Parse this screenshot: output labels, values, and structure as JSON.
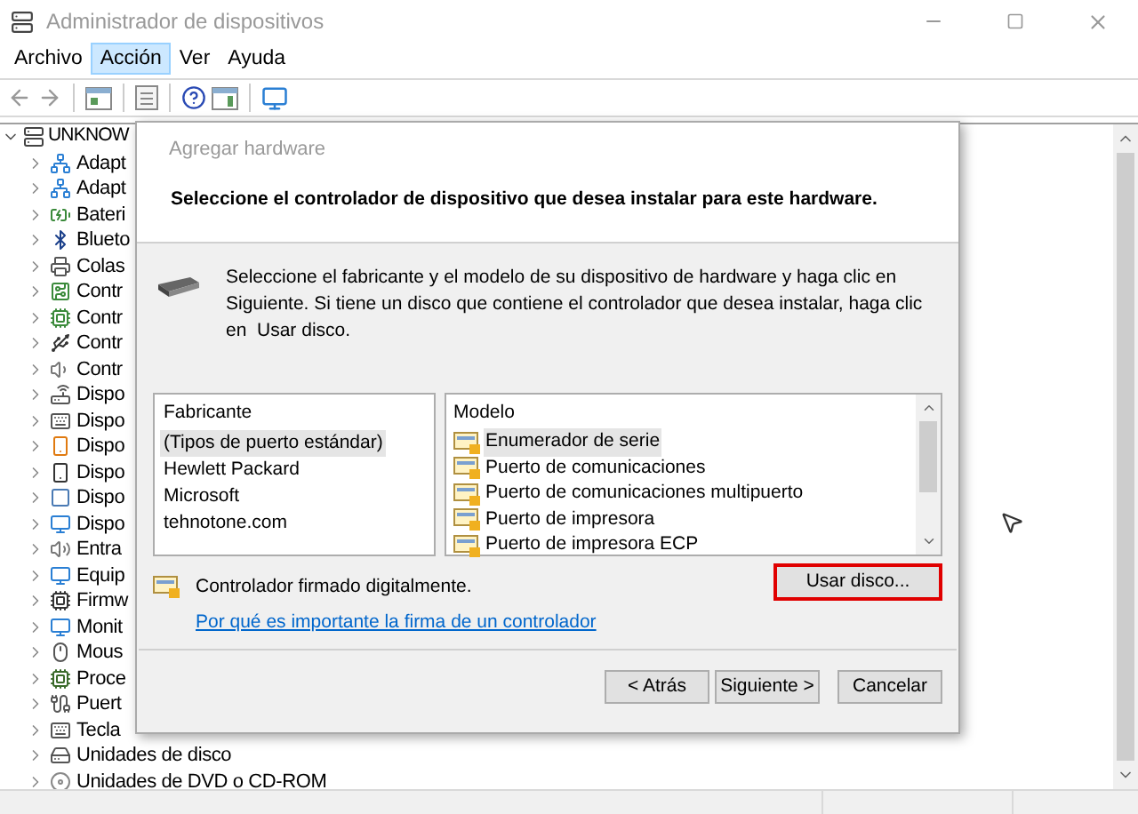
{
  "window": {
    "title": "Administrador de dispositivos"
  },
  "menu": [
    {
      "label": "Archivo",
      "selected": false
    },
    {
      "label": "Acción",
      "selected": true
    },
    {
      "label": "Ver",
      "selected": false
    },
    {
      "label": "Ayuda",
      "selected": false
    }
  ],
  "tree": {
    "label": "UNKNOW",
    "expanded": true,
    "children": [
      {
        "label": "Adapt",
        "expanded": false
      },
      {
        "label": "Adapt",
        "expanded": false
      },
      {
        "label": "Bateri",
        "expanded": false
      },
      {
        "label": "Blueto",
        "expanded": false
      },
      {
        "label": "Colas",
        "expanded": false
      },
      {
        "label": "Contr",
        "expanded": false
      },
      {
        "label": "Contr",
        "expanded": false
      },
      {
        "label": "Contr",
        "expanded": false
      },
      {
        "label": "Contr",
        "expanded": false
      },
      {
        "label": "Dispo",
        "expanded": false
      },
      {
        "label": "Dispo",
        "expanded": false
      },
      {
        "label": "Dispo",
        "expanded": false
      },
      {
        "label": "Dispo",
        "expanded": false
      },
      {
        "label": "Dispo",
        "expanded": false
      },
      {
        "label": "Dispo",
        "expanded": false
      },
      {
        "label": "Entra",
        "expanded": false
      },
      {
        "label": "Equip",
        "expanded": false
      },
      {
        "label": "Firmw",
        "expanded": false
      },
      {
        "label": "Monit",
        "expanded": false
      },
      {
        "label": "Mous",
        "expanded": false
      },
      {
        "label": "Proce",
        "expanded": false
      },
      {
        "label": "Puert",
        "expanded": false
      },
      {
        "label": "Tecla",
        "expanded": false
      },
      {
        "label": "Unidades de disco",
        "expanded": false
      },
      {
        "label": "Unidades de DVD o CD-ROM",
        "expanded": false
      }
    ]
  },
  "dialog": {
    "title": "Agregar hardware",
    "heading": "Seleccione el controlador de dispositivo que desea instalar para este hardware.",
    "instructions": "Seleccione el fabricante y el modelo de su dispositivo de hardware y haga clic en Siguiente. Si tiene un disco que contiene el controlador que desea instalar, haga clic en  Usar disco.",
    "manufacturers": {
      "header": "Fabricante",
      "items": [
        {
          "label": "(Tipos de puerto estándar)",
          "selected": true
        },
        {
          "label": "Hewlett Packard",
          "selected": false
        },
        {
          "label": "Microsoft",
          "selected": false
        },
        {
          "label": "tehnotone.com",
          "selected": false
        }
      ]
    },
    "models": {
      "header": "Modelo",
      "items": [
        {
          "label": "Enumerador de serie",
          "selected": true
        },
        {
          "label": "Puerto de comunicaciones",
          "selected": false
        },
        {
          "label": "Puerto de comunicaciones multipuerto",
          "selected": false
        },
        {
          "label": "Puerto de impresora",
          "selected": false
        },
        {
          "label": "Puerto de impresora ECP",
          "selected": false
        }
      ]
    },
    "signed_note": "Controlador firmado digitalmente.",
    "link": "Por qué es importante la firma de un controlador",
    "use_disk_button": {
      "label": "Usar disco...",
      "highlighted": true
    },
    "buttons": [
      "< Atrás",
      "Siguiente >",
      "Cancelar"
    ]
  }
}
